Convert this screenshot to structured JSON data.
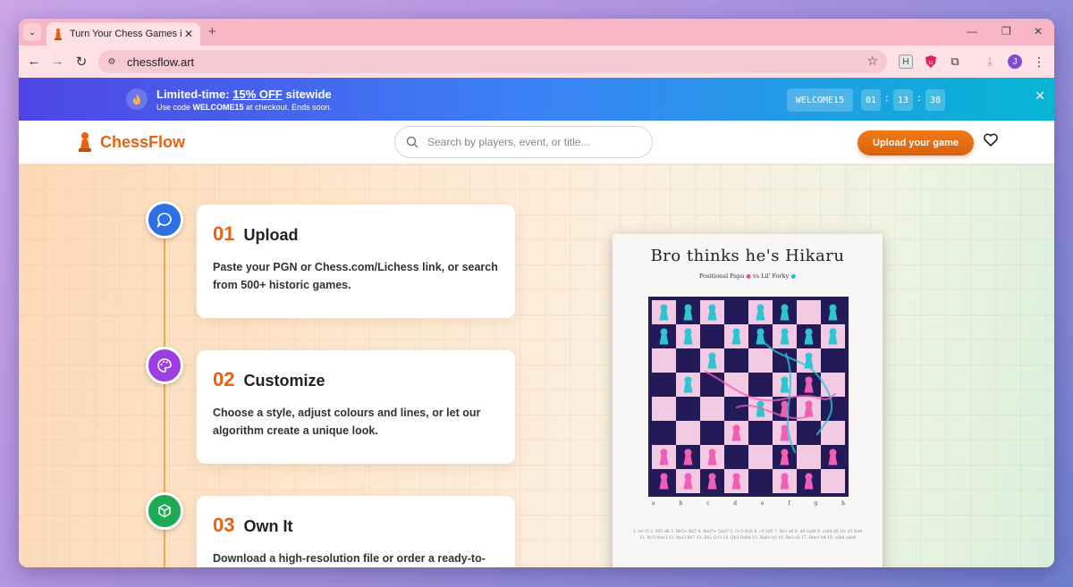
{
  "browser": {
    "tab_title": "Turn Your Chess Games into Stu",
    "url": "chessflow.art",
    "profile_initial": "J",
    "extension_h": "H"
  },
  "promo": {
    "headline_prefix": "Limited-time: ",
    "headline_offer": "15% OFF",
    "headline_suffix": " sitewide",
    "sub_prefix": "Use code ",
    "sub_code": "WELCOME15",
    "sub_suffix": " at checkout. Ends soon.",
    "code_badge": "WELCOME15",
    "timer": [
      "01",
      "13",
      "38"
    ],
    "colon": ":"
  },
  "header": {
    "brand": "ChessFlow",
    "search_placeholder": "Search by players, event, or title...",
    "upload_button": "Upload your game"
  },
  "steps": [
    {
      "num": "01",
      "title": "Upload",
      "desc": "Paste your PGN or Chess.com/Lichess link, or search from 500+ historic games.",
      "icon": "chat-bubble-icon",
      "color": "#2f6fe4"
    },
    {
      "num": "02",
      "title": "Customize",
      "desc": "Choose a style, adjust colours and lines, or let our algorithm create a unique look.",
      "icon": "palette-icon",
      "color": "#9b3fe0"
    },
    {
      "num": "03",
      "title": "Own It",
      "desc": "Download a high-resolution file or order a ready-to-",
      "icon": "cube-icon",
      "color": "#1faa55"
    }
  ],
  "poster": {
    "title": "Bro thinks he's Hikaru",
    "white_player": "Positional Papa",
    "vs": "vs",
    "black_player": "Lil' Forky",
    "files": [
      "a",
      "b",
      "c",
      "d",
      "e",
      "f",
      "g",
      "h"
    ],
    "moves": "1. e4 c5 2. Nf3 d6 3. Bb5+ Bd7 4. Bxd7+ Qxd7 5. O-O Nc6 6. c3 Nf6 7. Re1 e6 8. d4 cxd4 9. cxd4 d5 10. e5 Ne4 11. Nc3 Nxc3 12. bxc3 Be7 13. Bd2 O-O 14. Qb3 Rab8 15. Rab1 b5 16. Re3 a5 17. Rbe1 b4 18. cxb4 axb4"
  },
  "colors": {
    "accent": "#e8610f",
    "board_dark": "#231a58",
    "board_light": "#f4c9e4",
    "piece_pink": "#ef5fb5",
    "piece_cyan": "#2cc6d2"
  }
}
